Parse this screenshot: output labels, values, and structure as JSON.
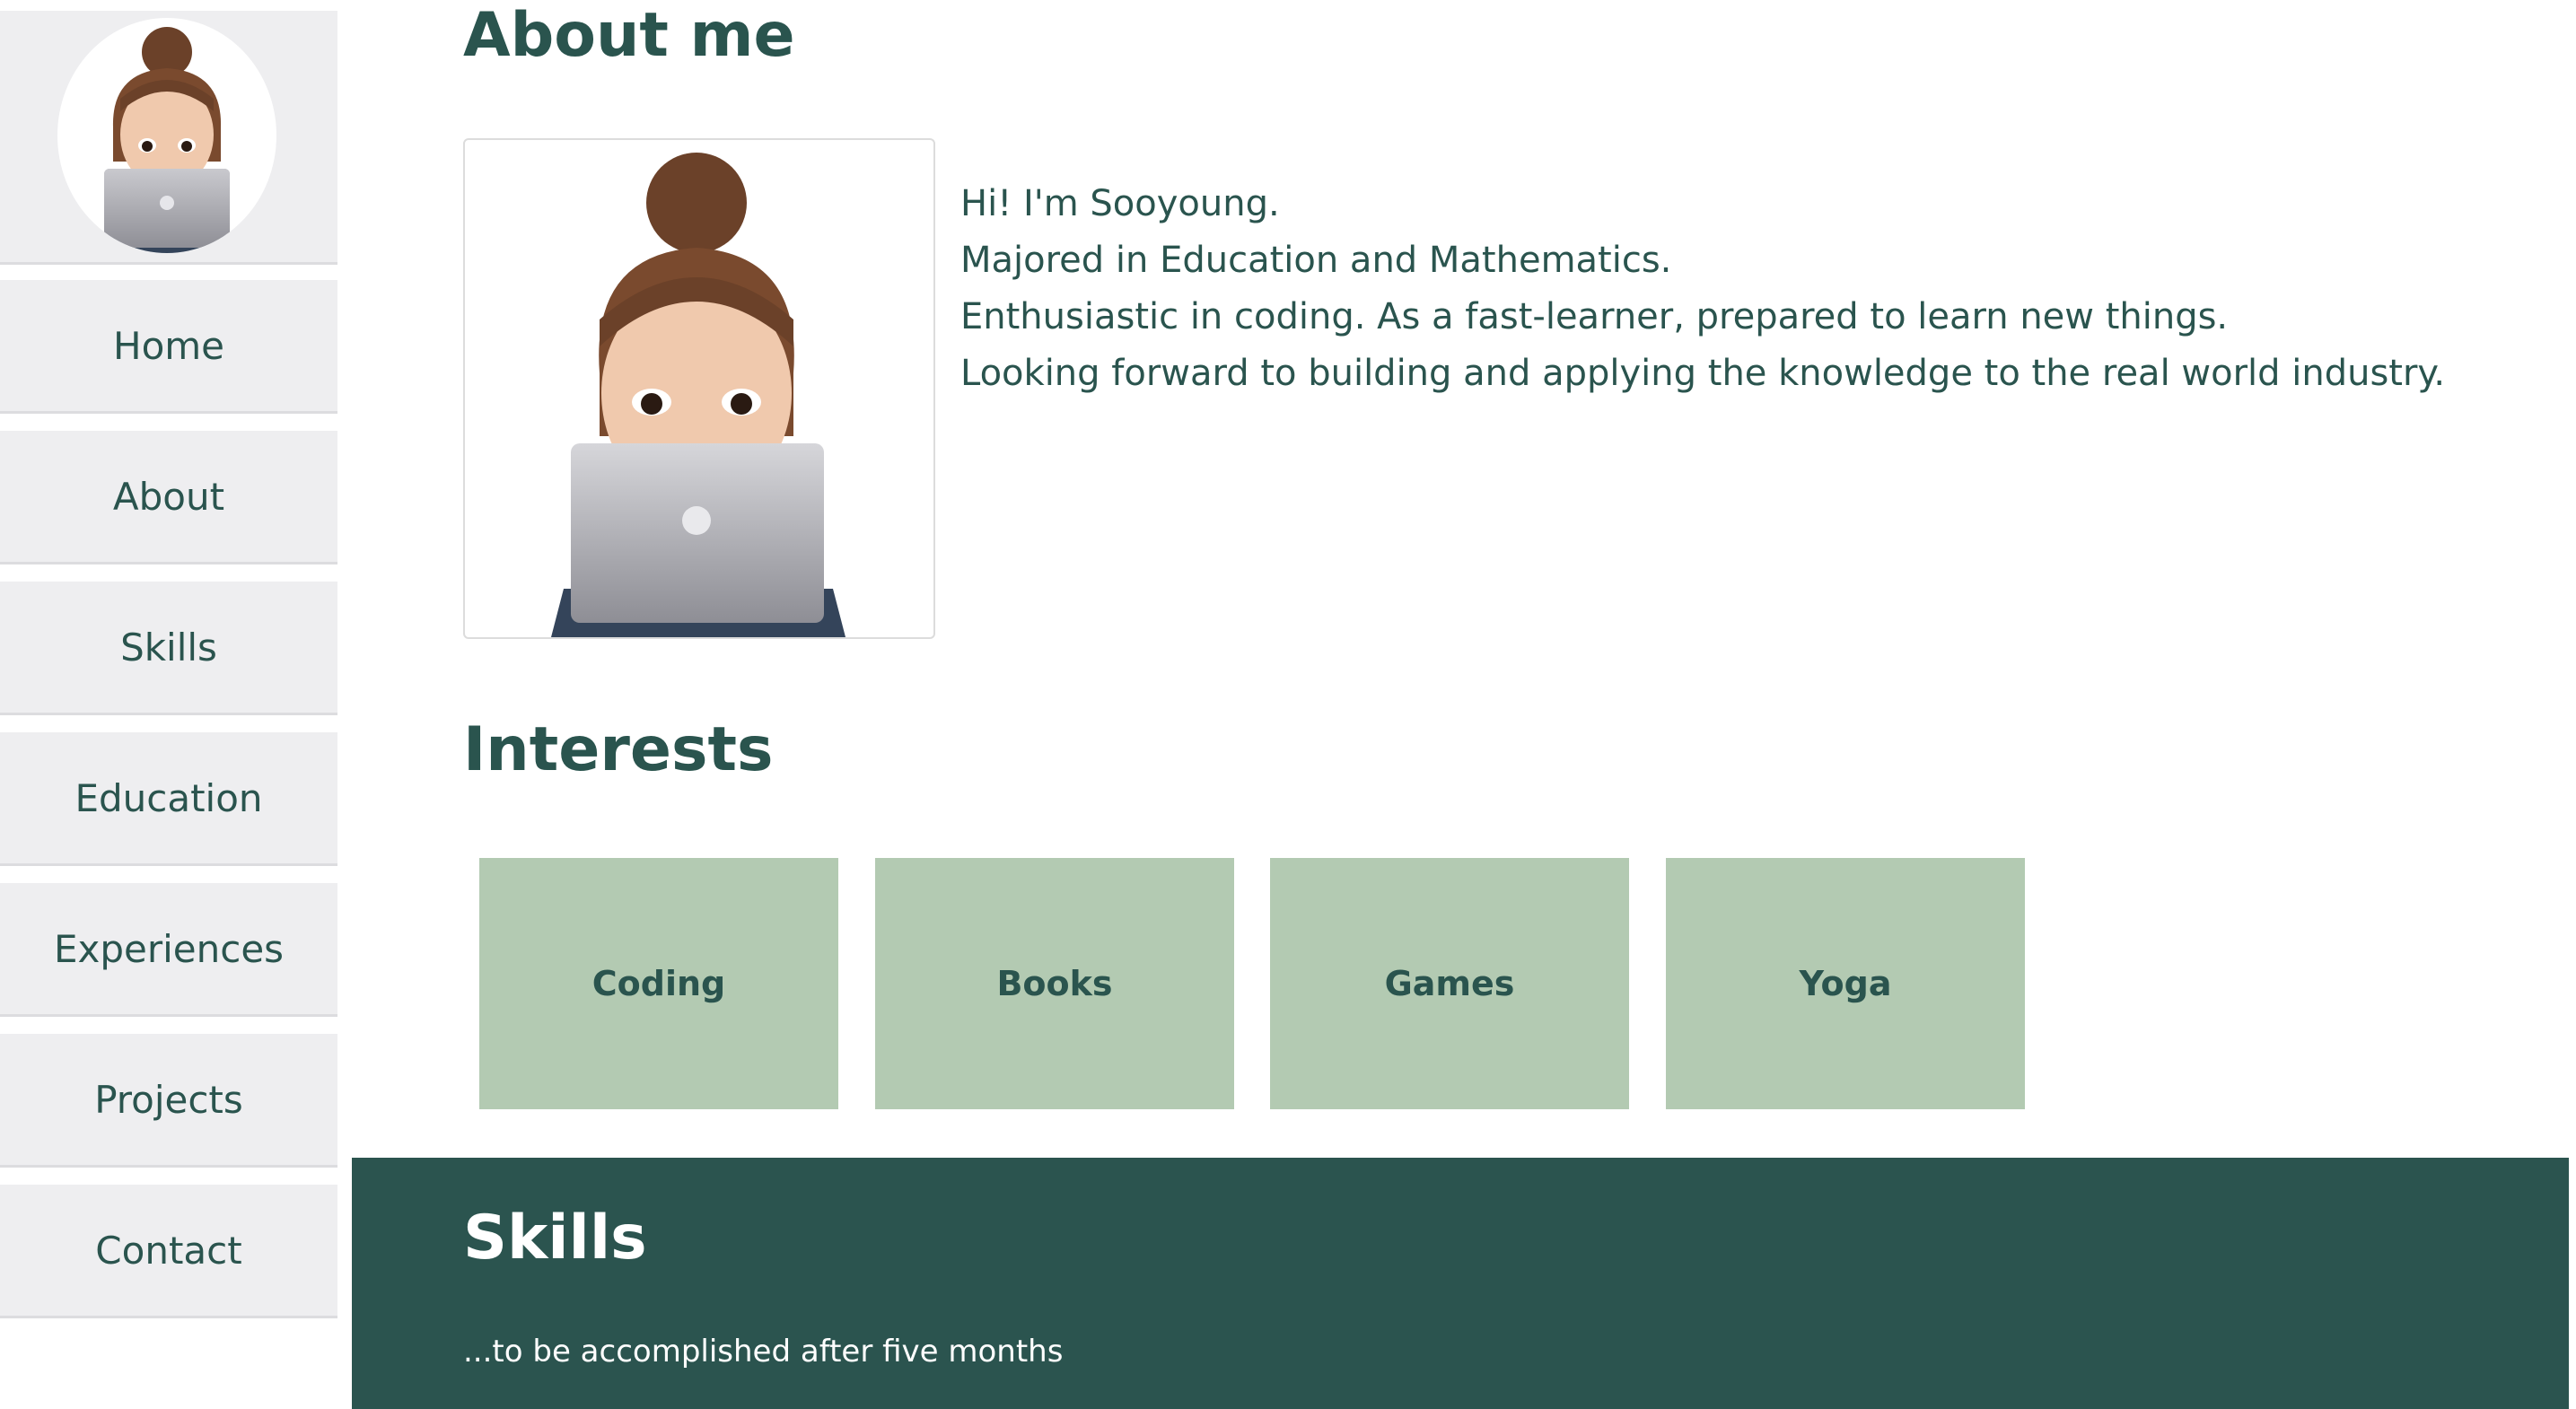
{
  "nav": {
    "items": [
      {
        "label": "Home"
      },
      {
        "label": "About"
      },
      {
        "label": "Skills"
      },
      {
        "label": "Education"
      },
      {
        "label": "Experiences"
      },
      {
        "label": "Projects"
      },
      {
        "label": "Contact"
      }
    ]
  },
  "about": {
    "title": "About me",
    "bio": [
      "Hi! I'm Sooyoung.",
      "Majored in Education and Mathematics.",
      "Enthusiastic in coding. As a fast-learner, prepared to learn new things.",
      "Looking forward to building and applying the knowledge to the real world industry."
    ]
  },
  "interests": {
    "title": "Interests",
    "cards": [
      {
        "label": "Coding"
      },
      {
        "label": "Books"
      },
      {
        "label": "Games"
      },
      {
        "label": "Yoga"
      }
    ]
  },
  "skills": {
    "title": "Skills",
    "subtitle": "...to be accomplished after five months"
  },
  "colors": {
    "accent": "#2a544e",
    "card": "#b3cab2",
    "sidebar": "#eeeef0",
    "band": "#2b544f"
  }
}
